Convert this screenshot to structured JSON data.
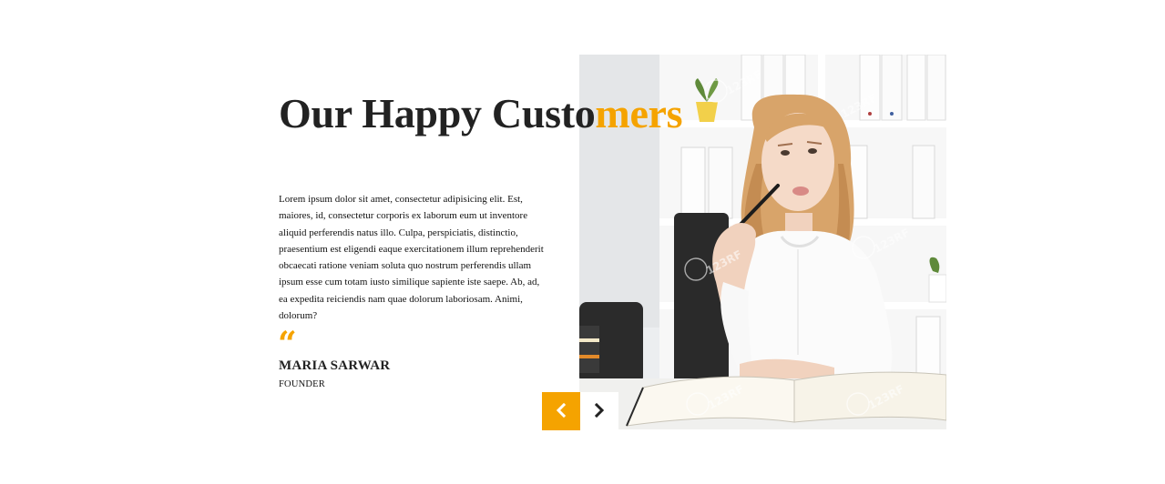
{
  "section": {
    "title_dark": "Our Happy Custo",
    "title_accent": "mers",
    "body": "Lorem ipsum dolor sit amet, consectetur adipisicing elit. Est, maiores, id, consectetur corporis ex laborum eum ut inventore aliquid perferendis natus illo. Culpa, perspiciatis, distinctio, praesentium est eligendi eaque exercitationem illum reprehenderit obcaecati ratione veniam soluta quo nostrum perferendis ullam ipsum esse cum totam iusto similique sapiente iste saepe. Ab, ad, ea expedita reiciendis nam quae dolorum laboriosam. Animi, dolorum?",
    "quote_mark": "“"
  },
  "testimonial": {
    "name": "MARIA SARWAR",
    "role": "FOUNDER"
  },
  "photo": {
    "subject": "woman-at-desk-with-pen",
    "watermark": "123RF"
  },
  "controls": {
    "prev_icon": "chevron-left-icon",
    "next_icon": "chevron-right-icon"
  },
  "colors": {
    "accent": "#f5a300",
    "heading": "#222222",
    "background": "#ffffff"
  }
}
